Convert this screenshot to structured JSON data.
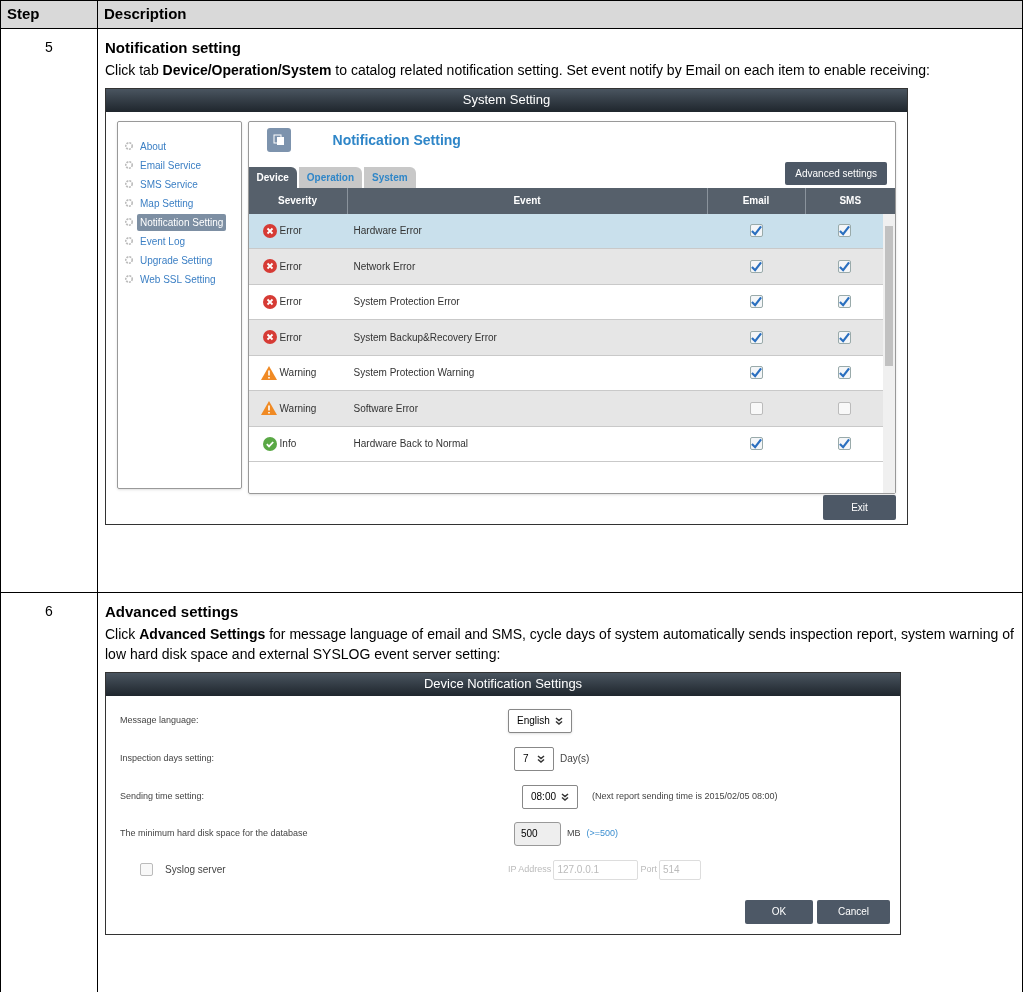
{
  "table": {
    "columns": [
      "Step",
      "Description"
    ],
    "rows": [
      {
        "step": "5",
        "title": "Notification setting",
        "text": "Click tab **Device/Operation/System** to catalog related notification setting. Set event notify by Email on each item to enable receiving:",
        "screenshot": {
          "kind": "system_setting",
          "window_title": "System Setting",
          "sidebar": [
            {
              "label": "About",
              "selected": false
            },
            {
              "label": "Email Service",
              "selected": false
            },
            {
              "label": "SMS Service",
              "selected": false
            },
            {
              "label": "Map Setting",
              "selected": false
            },
            {
              "label": "Notification Setting",
              "selected": true
            },
            {
              "label": "Event Log",
              "selected": false
            },
            {
              "label": "Upgrade Setting",
              "selected": false
            },
            {
              "label": "Web SSL Setting",
              "selected": false
            }
          ],
          "heading": "Notification Setting",
          "tabs": [
            {
              "label": "Device",
              "selected": true
            },
            {
              "label": "Operation",
              "selected": false
            },
            {
              "label": "System",
              "selected": false
            }
          ],
          "advanced_button": "Advanced settings",
          "columns": [
            "Severity",
            "Event",
            "Email",
            "SMS"
          ],
          "rows": [
            {
              "kind": "error",
              "severity": "Error",
              "event": "Hardware Error",
              "email": true,
              "sms": true,
              "selected": true
            },
            {
              "kind": "error",
              "severity": "Error",
              "event": "Network Error",
              "email": true,
              "sms": true,
              "selected": false
            },
            {
              "kind": "error",
              "severity": "Error",
              "event": "System Protection Error",
              "email": true,
              "sms": true,
              "selected": false
            },
            {
              "kind": "error",
              "severity": "Error",
              "event": "System Backup&Recovery Error",
              "email": true,
              "sms": true,
              "selected": false
            },
            {
              "kind": "warning",
              "severity": "Warning",
              "event": "System Protection Warning",
              "email": true,
              "sms": true,
              "selected": false
            },
            {
              "kind": "warning",
              "severity": "Warning",
              "event": "Software Error",
              "email": false,
              "sms": false,
              "selected": false
            },
            {
              "kind": "info",
              "severity": "Info",
              "event": "Hardware Back to Normal",
              "email": true,
              "sms": true,
              "selected": false
            }
          ],
          "exit_button": "Exit"
        }
      },
      {
        "step": "6",
        "title": "Advanced settings",
        "text": "Click **Advanced Settings** for message language of email and SMS, cycle days of system automatically sends inspection report, system warning of low hard disk space and external SYSLOG event server setting:",
        "screenshot": {
          "kind": "notification_dialog",
          "window_title": "Device Notification Settings",
          "language": {
            "label": "Message language:",
            "value": "English"
          },
          "inspection": {
            "label": "Inspection days setting:",
            "value": "7",
            "unit": "Day(s)"
          },
          "sending_time": {
            "label": "Sending time setting:",
            "value": "08:00",
            "note": "(Next report sending time is 2015/02/05 08:00)"
          },
          "disk": {
            "label": "The minimum hard disk space for the database",
            "value": "500",
            "unit": "MB",
            "hint": "(>=500)"
          },
          "syslog": {
            "label": "Syslog server",
            "checked": false,
            "ip_label": "IP Address",
            "ip_value": "127.0.0.1",
            "port_label": "Port",
            "port_value": "514"
          },
          "buttons": [
            "OK",
            "Cancel"
          ]
        }
      }
    ]
  }
}
